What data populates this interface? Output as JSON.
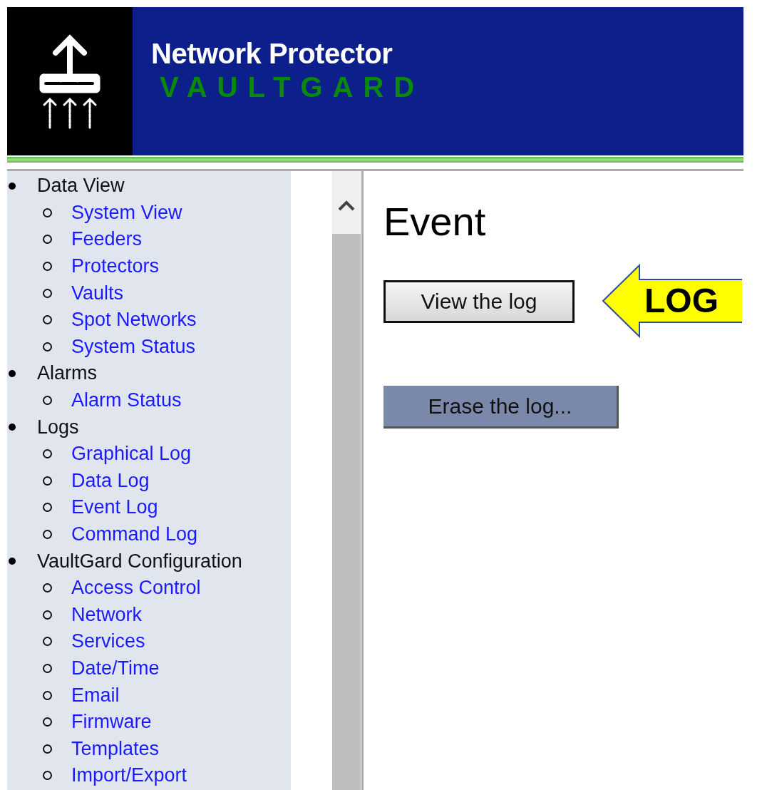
{
  "header": {
    "title": "Network Protector",
    "brand": "VAULTGARD"
  },
  "sidebar": {
    "groups": [
      {
        "label": "Data View",
        "children": [
          {
            "label": "System View"
          },
          {
            "label": "Feeders"
          },
          {
            "label": "Protectors"
          },
          {
            "label": "Vaults"
          },
          {
            "label": "Spot Networks"
          },
          {
            "label": "System Status"
          }
        ]
      },
      {
        "label": "Alarms",
        "children": [
          {
            "label": "Alarm Status"
          }
        ]
      },
      {
        "label": "Logs",
        "children": [
          {
            "label": "Graphical Log"
          },
          {
            "label": "Data Log"
          },
          {
            "label": "Event Log"
          },
          {
            "label": "Command Log"
          }
        ]
      },
      {
        "label": "VaultGard Configuration",
        "children": [
          {
            "label": "Access Control"
          },
          {
            "label": "Network"
          },
          {
            "label": "Services"
          },
          {
            "label": "Date/Time"
          },
          {
            "label": "Email"
          },
          {
            "label": "Firmware"
          },
          {
            "label": "Templates"
          },
          {
            "label": "Import/Export"
          }
        ]
      }
    ]
  },
  "content": {
    "heading": "Event",
    "buttons": [
      {
        "label": "View the log",
        "kind": "raised"
      },
      {
        "label": "Erase the log...",
        "kind": "flat"
      }
    ]
  },
  "annotation": {
    "label": "LOG"
  }
}
